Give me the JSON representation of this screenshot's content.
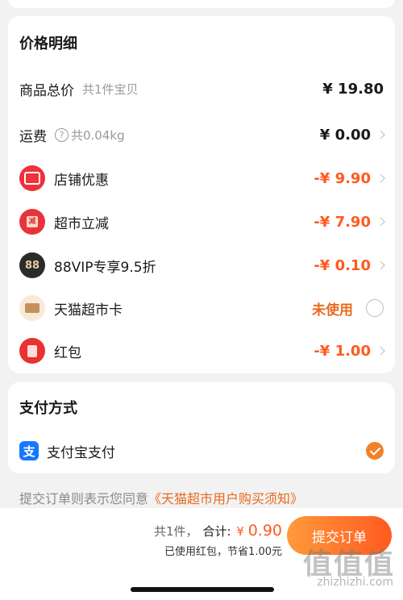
{
  "price_details": {
    "title": "价格明细",
    "goods_total": {
      "label": "商品总价",
      "sub": "共1件宝贝",
      "amount": "¥ 19.80"
    },
    "shipping": {
      "label": "运费",
      "sub": "共0.04kg",
      "amount": "¥ 0.00",
      "help_glyph": "?"
    },
    "store_discount": {
      "label": "店铺优惠",
      "amount": "-¥ 9.90",
      "icon": "ticket-icon"
    },
    "market_discount": {
      "label": "超市立减",
      "amount": "-¥ 7.90",
      "icon": "reduce-icon",
      "icon_text": "减"
    },
    "vip_discount": {
      "label": "88VIP专享9.5折",
      "amount": "-¥ 0.10",
      "icon": "vip88-icon",
      "icon_text": "88"
    },
    "tmall_card": {
      "label": "天猫超市卡",
      "status": "未使用",
      "icon": "card-icon"
    },
    "red_packet": {
      "label": "红包",
      "amount": "-¥ 1.00",
      "icon": "red-packet-icon"
    }
  },
  "payment": {
    "title": "支付方式",
    "method": {
      "label": "支付宝支付",
      "icon": "alipay-icon",
      "icon_text": "支",
      "selected": true
    }
  },
  "agreement": {
    "prefix": "提交订单则表示您同意",
    "link": "《天猫超市用户购买须知》"
  },
  "bottom_bar": {
    "count": "共1件，",
    "total_label": "合计:",
    "currency": "¥",
    "total": "0.90",
    "saving_note": "已使用红包，节省1.00元",
    "submit_label": "提交订单"
  },
  "watermark": {
    "text": "值值值",
    "url": "zhizhizhi.com"
  },
  "colors": {
    "accent": "#ff5a1f",
    "background": "#f2f2f2",
    "alipay": "#1677ff"
  }
}
